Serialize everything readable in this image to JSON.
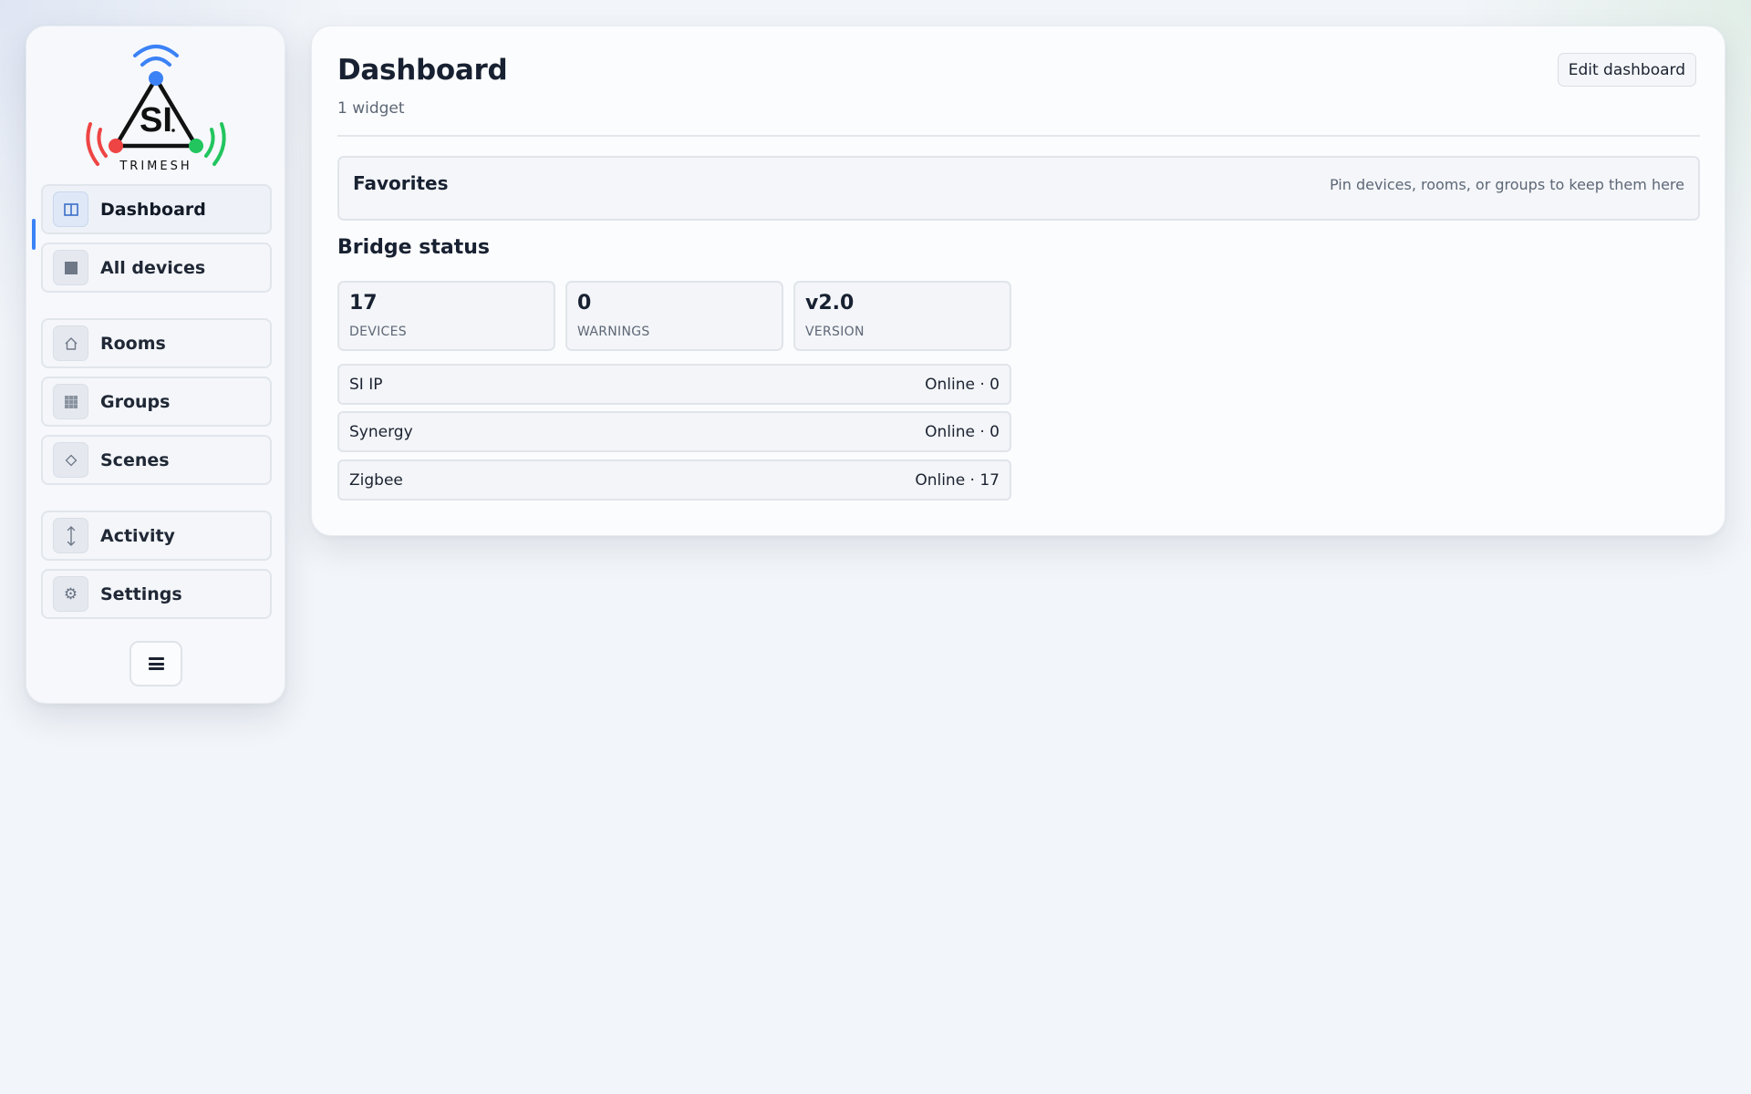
{
  "logo": {
    "text": "SI",
    "wordmark": "TRIMESH",
    "colors": {
      "top": "#3b82f6",
      "left": "#ef4444",
      "right": "#22c55e"
    }
  },
  "sidebar": {
    "items": [
      {
        "label": "Dashboard",
        "icon": "dashboard-icon",
        "active": true
      },
      {
        "label": "All devices",
        "icon": "devices-icon"
      },
      {
        "label": "Rooms",
        "icon": "home-icon"
      },
      {
        "label": "Groups",
        "icon": "grid-icon"
      },
      {
        "label": "Scenes",
        "icon": "diamond-icon"
      },
      {
        "label": "Activity",
        "icon": "updown-arrow-icon"
      },
      {
        "label": "Settings",
        "icon": "gear-icon"
      }
    ],
    "menu_icon": "hamburger-icon"
  },
  "header": {
    "title": "Dashboard",
    "subtitle": "1 widget",
    "edit_label": "Edit dashboard"
  },
  "favorites": {
    "title": "Favorites",
    "hint": "Pin devices, rooms, or groups to keep them here"
  },
  "bridge_status": {
    "title": "Bridge status",
    "stats": [
      {
        "value": "17",
        "label": "DEVICES"
      },
      {
        "value": "0",
        "label": "WARNINGS"
      },
      {
        "value": "v2.0",
        "label": "VERSION"
      }
    ],
    "bridges": [
      {
        "name": "SI IP",
        "status": "Online · 0"
      },
      {
        "name": "Synergy",
        "status": "Online · 0"
      },
      {
        "name": "Zigbee",
        "status": "Online · 17"
      }
    ]
  },
  "colors": {
    "accent": "#3b82f6",
    "background": "#f2f5f9",
    "panel": "#fbfcfd"
  }
}
